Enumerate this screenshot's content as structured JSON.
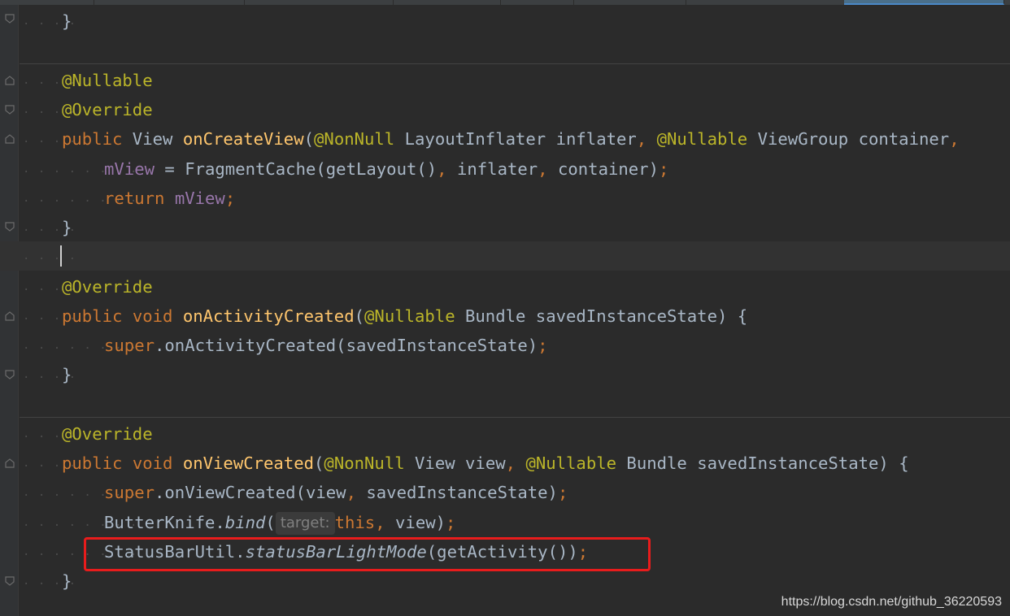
{
  "editor": {
    "lines": [
      {
        "id": "l1",
        "parts": [
          {
            "t": "}",
            "c": ""
          }
        ]
      },
      {
        "id": "l3",
        "parts": [
          {
            "t": "@Nullable",
            "c": "ann"
          }
        ]
      },
      {
        "id": "l4",
        "parts": [
          {
            "t": "@Override",
            "c": "ann"
          }
        ]
      },
      {
        "id": "l5",
        "parts": [
          {
            "t": "public",
            "c": "kw"
          },
          {
            "t": " View ",
            "c": ""
          },
          {
            "t": "onCreateView",
            "c": "fn"
          },
          {
            "t": "(",
            "c": ""
          },
          {
            "t": "@NonNull",
            "c": "ann"
          },
          {
            "t": " LayoutInflater inflater",
            "c": ""
          },
          {
            "t": ",",
            "c": "kw"
          },
          {
            "t": " ",
            "c": ""
          },
          {
            "t": "@Nullable",
            "c": "ann"
          },
          {
            "t": " ViewGroup container",
            "c": ""
          },
          {
            "t": ",",
            "c": "kw"
          }
        ]
      },
      {
        "id": "l6",
        "parts": [
          {
            "t": "mView",
            "c": "fld"
          },
          {
            "t": " = FragmentCache(getLayout()",
            "c": ""
          },
          {
            "t": ",",
            "c": "kw"
          },
          {
            "t": " inflater",
            "c": ""
          },
          {
            "t": ",",
            "c": "kw"
          },
          {
            "t": " container)",
            "c": ""
          },
          {
            "t": ";",
            "c": "kw"
          }
        ]
      },
      {
        "id": "l7",
        "parts": [
          {
            "t": "return",
            "c": "kw"
          },
          {
            "t": " ",
            "c": ""
          },
          {
            "t": "mView",
            "c": "fld"
          },
          {
            "t": ";",
            "c": "kw"
          }
        ]
      },
      {
        "id": "l8",
        "parts": [
          {
            "t": "}",
            "c": ""
          }
        ]
      },
      {
        "id": "l10",
        "parts": [
          {
            "t": "@Override",
            "c": "ann"
          }
        ]
      },
      {
        "id": "l11",
        "parts": [
          {
            "t": "public",
            "c": "kw"
          },
          {
            "t": " ",
            "c": ""
          },
          {
            "t": "void",
            "c": "kw"
          },
          {
            "t": " ",
            "c": ""
          },
          {
            "t": "onActivityCreated",
            "c": "fn"
          },
          {
            "t": "(",
            "c": ""
          },
          {
            "t": "@Nullable",
            "c": "ann"
          },
          {
            "t": " Bundle savedInstanceState) {",
            "c": ""
          }
        ]
      },
      {
        "id": "l12",
        "parts": [
          {
            "t": "super",
            "c": "kw"
          },
          {
            "t": ".onActivityCreated(savedInstanceState)",
            "c": ""
          },
          {
            "t": ";",
            "c": "kw"
          }
        ]
      },
      {
        "id": "l13",
        "parts": [
          {
            "t": "}",
            "c": ""
          }
        ]
      },
      {
        "id": "l15",
        "parts": [
          {
            "t": "@Override",
            "c": "ann"
          }
        ]
      },
      {
        "id": "l16",
        "parts": [
          {
            "t": "public",
            "c": "kw"
          },
          {
            "t": " ",
            "c": ""
          },
          {
            "t": "void",
            "c": "kw"
          },
          {
            "t": " ",
            "c": ""
          },
          {
            "t": "onViewCreated",
            "c": "fn"
          },
          {
            "t": "(",
            "c": ""
          },
          {
            "t": "@NonNull",
            "c": "ann"
          },
          {
            "t": " View view",
            "c": ""
          },
          {
            "t": ",",
            "c": "kw"
          },
          {
            "t": " ",
            "c": ""
          },
          {
            "t": "@Nullable",
            "c": "ann"
          },
          {
            "t": " Bundle savedInstanceState) {",
            "c": ""
          }
        ]
      },
      {
        "id": "l17",
        "parts": [
          {
            "t": "super",
            "c": "kw"
          },
          {
            "t": ".onViewCreated(view",
            "c": ""
          },
          {
            "t": ",",
            "c": "kw"
          },
          {
            "t": " savedInstanceState)",
            "c": ""
          },
          {
            "t": ";",
            "c": "kw"
          }
        ]
      },
      {
        "id": "l18",
        "parts": [
          {
            "t": "ButterKnife.",
            "c": ""
          },
          {
            "t": "bind",
            "c": "it"
          },
          {
            "t": "(",
            "c": ""
          },
          {
            "t": "target:",
            "c": "hint"
          },
          {
            "t": "this",
            "c": "kw"
          },
          {
            "t": ",",
            "c": "kw"
          },
          {
            "t": " view)",
            "c": ""
          },
          {
            "t": ";",
            "c": "kw"
          }
        ]
      },
      {
        "id": "l19",
        "parts": [
          {
            "t": "StatusBarUtil.",
            "c": ""
          },
          {
            "t": "statusBarLightMode",
            "c": "it"
          },
          {
            "t": "(getActivity())",
            "c": ""
          },
          {
            "t": ";",
            "c": "kw"
          }
        ]
      },
      {
        "id": "l20",
        "parts": [
          {
            "t": "}",
            "c": ""
          }
        ]
      }
    ]
  },
  "watermark": "https://blog.csdn.net/github_36220593",
  "colors": {
    "background": "#2b2b2b",
    "keyword": "#cc7832",
    "annotation": "#bbb529",
    "method": "#ffc66d",
    "field": "#9876aa",
    "text": "#a9b7c6",
    "highlight_box": "#e81c1c"
  }
}
